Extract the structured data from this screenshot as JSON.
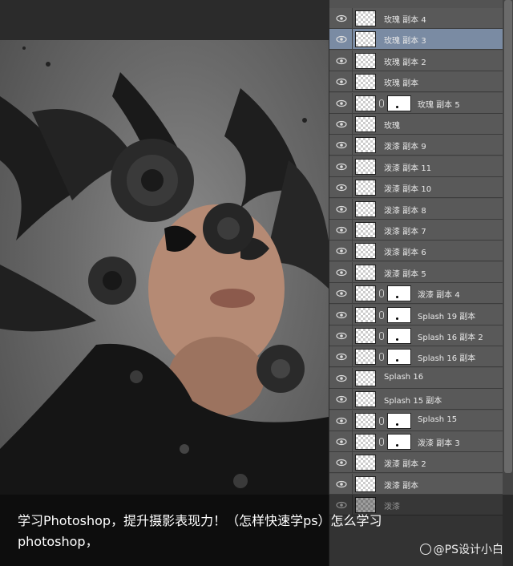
{
  "layers": [
    {
      "label": "玫瑰 副本 4",
      "mask": false,
      "selected": false
    },
    {
      "label": "玫瑰 副本 3",
      "mask": false,
      "selected": true
    },
    {
      "label": "玫瑰 副本 2",
      "mask": false,
      "selected": false
    },
    {
      "label": "玫瑰 副本",
      "mask": false,
      "selected": false
    },
    {
      "label": "玫瑰 副本 5",
      "mask": true,
      "selected": false
    },
    {
      "label": "玫瑰",
      "mask": false,
      "selected": false
    },
    {
      "label": "泼漆 副本 9",
      "mask": false,
      "selected": false
    },
    {
      "label": "泼漆 副本 11",
      "mask": false,
      "selected": false
    },
    {
      "label": "泼漆 副本 10",
      "mask": false,
      "selected": false
    },
    {
      "label": "泼漆 副本 8",
      "mask": false,
      "selected": false
    },
    {
      "label": "泼漆 副本 7",
      "mask": false,
      "selected": false
    },
    {
      "label": "泼漆 副本 6",
      "mask": false,
      "selected": false
    },
    {
      "label": "泼漆 副本 5",
      "mask": false,
      "selected": false
    },
    {
      "label": "泼漆 副本 4",
      "mask": true,
      "selected": false
    },
    {
      "label": "Splash 19 副本",
      "mask": true,
      "selected": false
    },
    {
      "label": "Splash 16 副本 2",
      "mask": true,
      "selected": false
    },
    {
      "label": "Splash 16 副本",
      "mask": true,
      "selected": false
    },
    {
      "label": "Splash 16",
      "mask": false,
      "selected": false
    },
    {
      "label": "Splash 15 副本",
      "mask": false,
      "selected": false
    },
    {
      "label": "Splash 15",
      "mask": true,
      "selected": false
    },
    {
      "label": "泼漆 副本 3",
      "mask": true,
      "selected": false
    },
    {
      "label": "泼漆 副本 2",
      "mask": false,
      "selected": false
    },
    {
      "label": "泼漆 副本",
      "mask": false,
      "selected": false
    },
    {
      "label": "泼漆",
      "mask": false,
      "selected": false
    }
  ],
  "caption": {
    "text": "学习Photoshop，提升摄影表现力！（怎样快速学ps）怎么学习photoshop，"
  },
  "watermark": {
    "text": "@PS设计小白"
  }
}
